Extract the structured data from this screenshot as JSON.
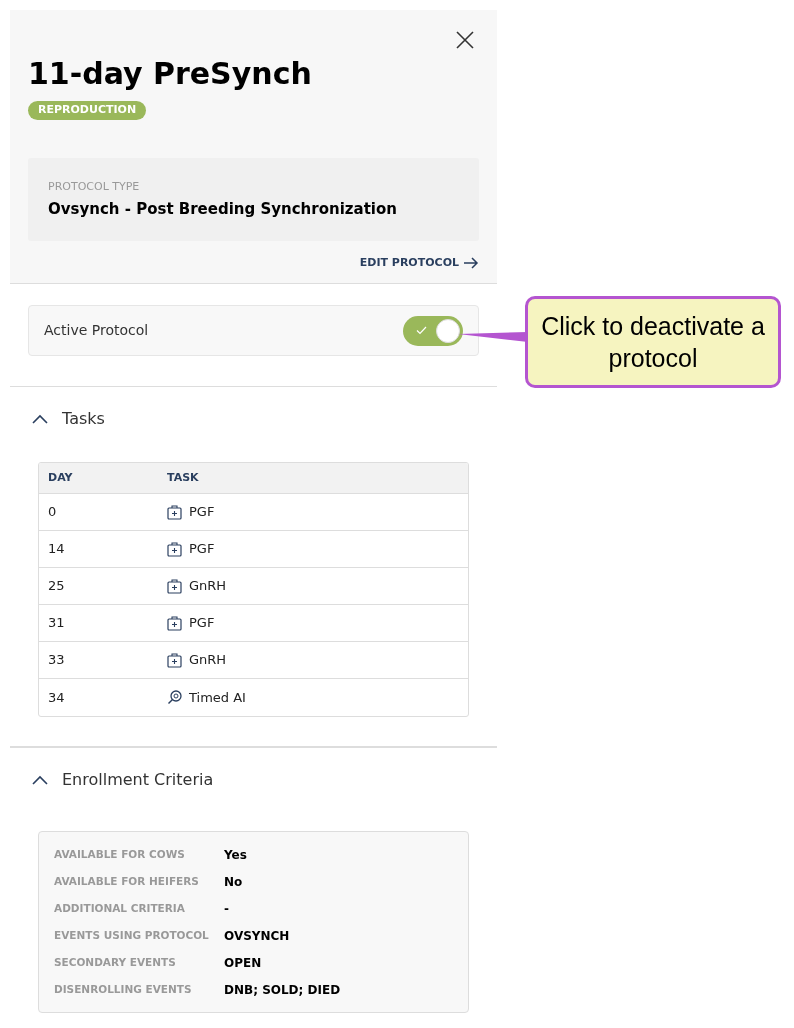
{
  "panel": {
    "title": "11-day PreSynch",
    "category": "REPRODUCTION",
    "protocol_type_label": "PROTOCOL TYPE",
    "protocol_type": "Ovsynch - Post Breeding Synchronization",
    "edit_link": "EDIT PROTOCOL"
  },
  "active_protocol": {
    "label": "Active Protocol",
    "on": true
  },
  "callout": {
    "text": "Click to deactivate a protocol"
  },
  "tasks": {
    "title": "Tasks",
    "expanded": true,
    "columns": [
      "DAY",
      "TASK"
    ],
    "rows": [
      {
        "day": "0",
        "task": "PGF",
        "kind": "treatment"
      },
      {
        "day": "14",
        "task": "PGF",
        "kind": "treatment"
      },
      {
        "day": "25",
        "task": "GnRH",
        "kind": "treatment"
      },
      {
        "day": "31",
        "task": "PGF",
        "kind": "treatment"
      },
      {
        "day": "33",
        "task": "GnRH",
        "kind": "treatment"
      },
      {
        "day": "34",
        "task": "Timed AI",
        "kind": "insemination"
      }
    ]
  },
  "enrollment": {
    "title": "Enrollment Criteria",
    "expanded": true,
    "rows": [
      {
        "label": "AVAILABLE FOR COWS",
        "value": "Yes"
      },
      {
        "label": "AVAILABLE FOR HEIFERS",
        "value": "No"
      },
      {
        "label": "ADDITIONAL CRITERIA",
        "value": "-"
      },
      {
        "label": "EVENTS USING PROTOCOL",
        "value": "OVSYNCH"
      },
      {
        "label": "SECONDARY EVENTS",
        "value": "OPEN"
      },
      {
        "label": "DISENROLLING EVENTS",
        "value": "DNB; SOLD; DIED"
      }
    ]
  }
}
